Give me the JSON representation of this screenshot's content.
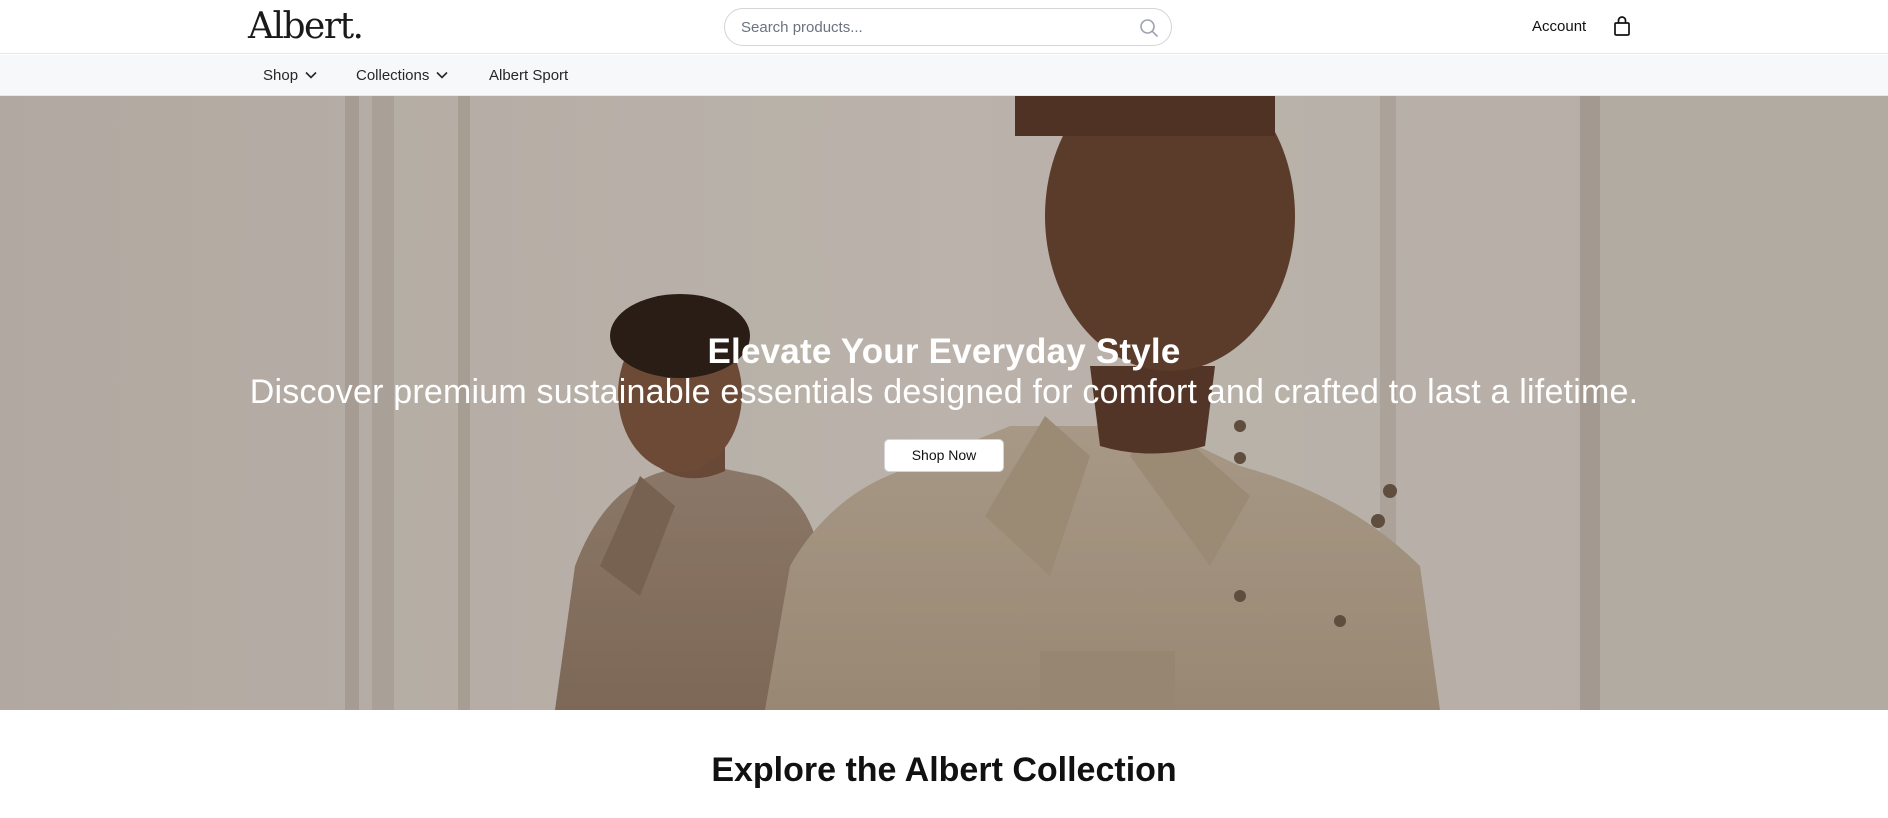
{
  "header": {
    "logo": "Albert.",
    "search": {
      "placeholder": "Search products...",
      "value": ""
    },
    "account_label": "Account"
  },
  "nav": {
    "items": [
      {
        "label": "Shop",
        "has_dropdown": true
      },
      {
        "label": "Collections",
        "has_dropdown": true
      },
      {
        "label": "Albert Sport",
        "has_dropdown": false
      }
    ]
  },
  "hero": {
    "title": "Elevate Your Everyday Style",
    "subtitle": "Discover premium sustainable essentials designed for comfort and crafted to last a lifetime.",
    "cta_label": "Shop Now"
  },
  "sections": {
    "explore_title": "Explore the Albert Collection"
  },
  "icons": {
    "search": "search-icon",
    "bag": "shopping-bag-icon",
    "dropdown": "chevron-down-icon"
  },
  "colors": {
    "header_bg": "#ffffff",
    "nav_bg": "#f7f8fa",
    "text": "#111111",
    "hero_text": "#ffffff",
    "button_bg": "#ffffff"
  }
}
